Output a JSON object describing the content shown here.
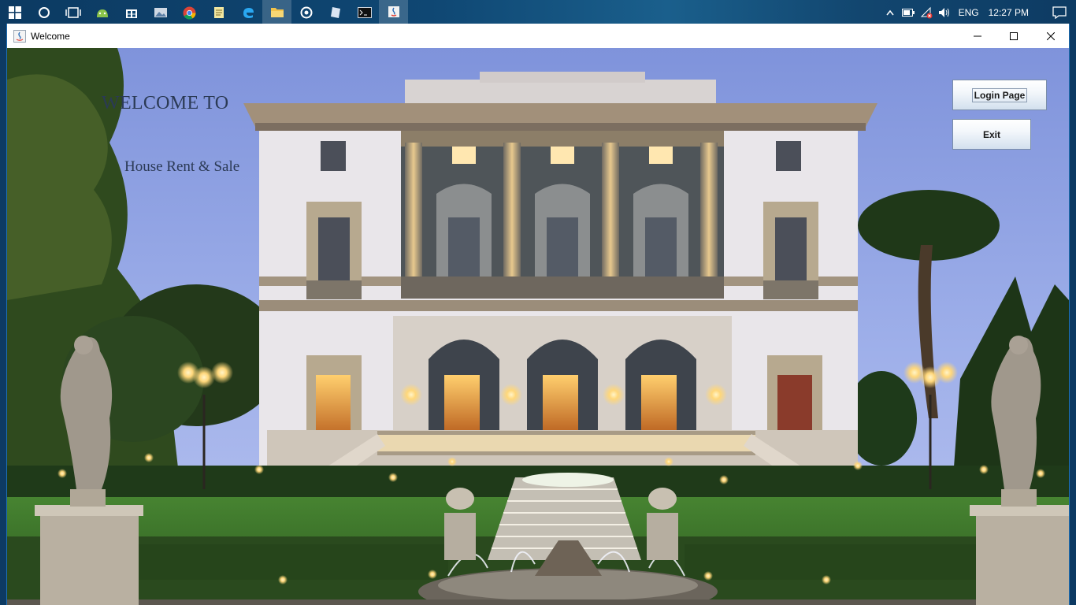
{
  "taskbar": {
    "icons": [
      "windows-start-icon",
      "cortana-search-icon",
      "task-view-icon",
      "android-studio-icon",
      "microsoft-store-icon",
      "photos-icon",
      "chrome-icon",
      "notes-icon",
      "edge-icon",
      "file-explorer-icon",
      "media-player-icon",
      "document-icon",
      "command-prompt-icon",
      "java-app-icon"
    ],
    "tray": {
      "language": "ENG",
      "time": "12:27 PM"
    }
  },
  "window": {
    "title": "Welcome",
    "controls": [
      "minimize-icon",
      "maximize-icon",
      "close-icon"
    ]
  },
  "main": {
    "welcome_heading": "WELCOME TO",
    "subtitle": "House Rent & Sale",
    "login_button": "Login Page",
    "exit_button": "Exit"
  },
  "colors": {
    "taskbar": "#0f4773",
    "window_border": "#1e6fb5",
    "heading_text": "#2b3a55",
    "sky": "#8fa1e0",
    "villa_facade": "#e7e5ea",
    "lawn": "#3f7d2c"
  }
}
